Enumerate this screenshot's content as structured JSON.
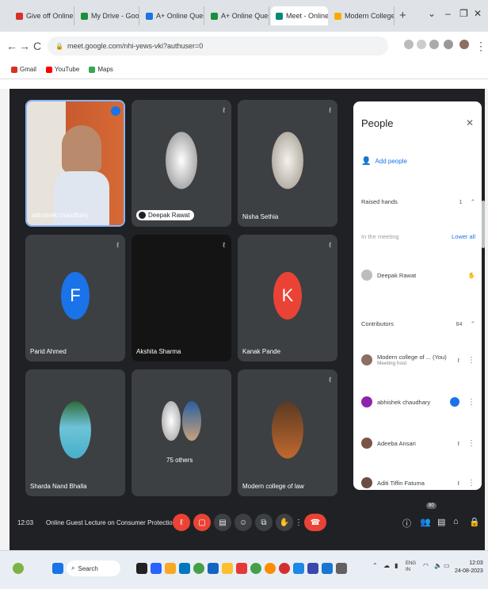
{
  "browser": {
    "tabs": [
      {
        "label": "Give off Online lecture",
        "color": "#d93025"
      },
      {
        "label": "My Drive - Google D",
        "color": "#1e8e3e"
      },
      {
        "label": "A+ Online Question",
        "color": "#1a73e8"
      },
      {
        "label": "A+ Online Question",
        "color": "#1e8e3e"
      },
      {
        "label": "Meet - Online G",
        "color": "#00897b"
      },
      {
        "label": "Modern College of ",
        "color": "#f9ab00"
      }
    ],
    "new_tab": "+",
    "url": "meet.google.com/nhi-yews-vki?authuser=0",
    "bookmarks": [
      "Gmail",
      "YouTube",
      "Maps"
    ]
  },
  "meet": {
    "tiles": [
      {
        "name": "abhishek chaudhary",
        "type": "video"
      },
      {
        "name": "Deepak Rawat",
        "type": "avatar"
      },
      {
        "name": "Nisha Sethia",
        "type": "avatar"
      },
      {
        "name": "Parid Ahmed",
        "type": "initial",
        "initial": "F",
        "color": "#1a73e8"
      },
      {
        "name": "Akshita Sharma",
        "type": "dark"
      },
      {
        "name": "Kanak Pande",
        "type": "initial",
        "initial": "K",
        "color": "#ea4335"
      },
      {
        "name": "Sharda Nand Bhalla",
        "type": "avatar"
      },
      {
        "name": "75 others",
        "type": "group"
      },
      {
        "name": "Modern college of law",
        "type": "avatar"
      }
    ],
    "bottom": {
      "time": "12:03",
      "title": "Online Guest Lecture on Consumer Protectio...",
      "people_badge": "80"
    }
  },
  "people_panel": {
    "title": "People",
    "add_people": "Add people",
    "raised_hands": "Raised hands",
    "raised_count": "1",
    "in_meeting_label": "In the meeting",
    "lower_all": "Lower all",
    "raised_person": "Deepak Rawat",
    "contributors_label": "Contributors",
    "contributors_count": "84",
    "contributors": [
      {
        "name": "Modern college of ... (You)",
        "sub": "Meeting host",
        "color": "#8d6e63"
      },
      {
        "name": "abhishek chaudhary",
        "sub": "",
        "color": "#8e24aa"
      },
      {
        "name": "Adeeba Ansari",
        "sub": "",
        "color": "#795548"
      },
      {
        "name": "Aditi Tiffin Fatuma",
        "sub": "",
        "color": "#6d4c41"
      }
    ]
  },
  "taskbar": {
    "search_label": "Search",
    "lang": "ENG\nIN",
    "time": "12:03",
    "date": "24-08-2023"
  }
}
